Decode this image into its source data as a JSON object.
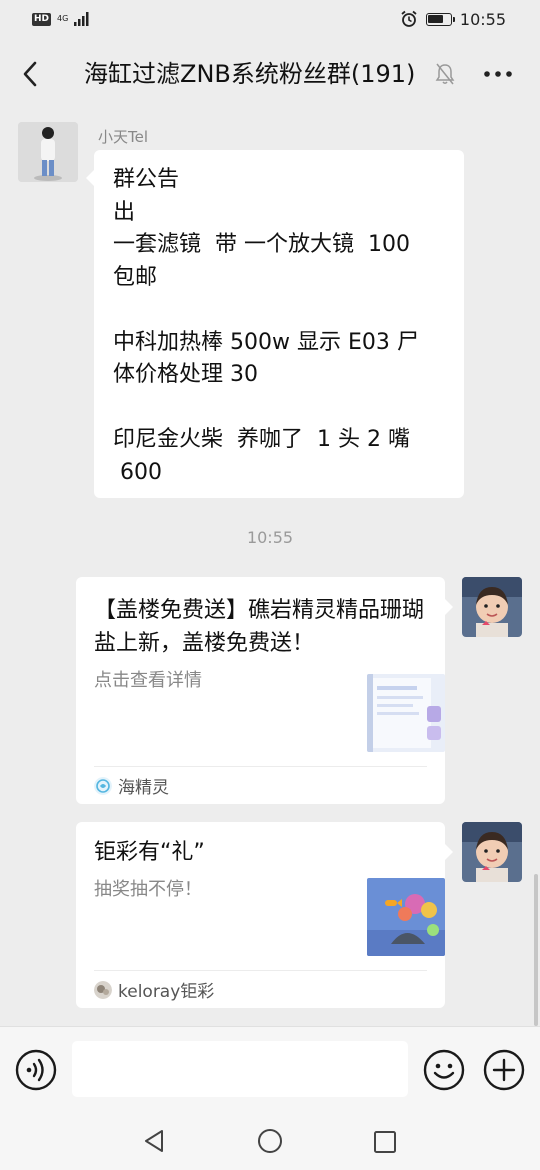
{
  "status_bar": {
    "hd": "HD",
    "network": "4G",
    "time": "10:55",
    "battery_level": 0.7
  },
  "header": {
    "title": "海缸过滤ZNB系统粉丝群(191)",
    "back_icon": "chevron-left-icon",
    "mute_icon": "bell-off-icon",
    "more_icon": "more-dots-icon"
  },
  "messages": {
    "announcement": {
      "sender": "小天Tel",
      "lines": [
        "群公告",
        "出",
        "一套滤镜  带 一个放大镜  100",
        "包邮",
        "",
        "中科加热棒 500w 显示 E03 尸",
        "体价格处理 30",
        "",
        "印尼金火柴  养咖了  1 头 2 嘴",
        " 600"
      ]
    },
    "timestamp": "10:55",
    "card1": {
      "title": "【盖楼免费送】礁岩精灵精品珊瑚盐上新，盖楼免费送！",
      "desc": "点击查看详情",
      "source": "海精灵"
    },
    "card2": {
      "title": "钜彩有“礼”",
      "desc": "抽奖抽不停！",
      "source": "keloray钜彩"
    }
  },
  "input_bar": {
    "voice_icon": "voice-icon",
    "emoji_icon": "emoji-icon",
    "plus_icon": "plus-circle-icon",
    "value": ""
  },
  "system_nav": {
    "back": "nav-back-icon",
    "home": "nav-home-icon",
    "recents": "nav-recents-icon"
  }
}
